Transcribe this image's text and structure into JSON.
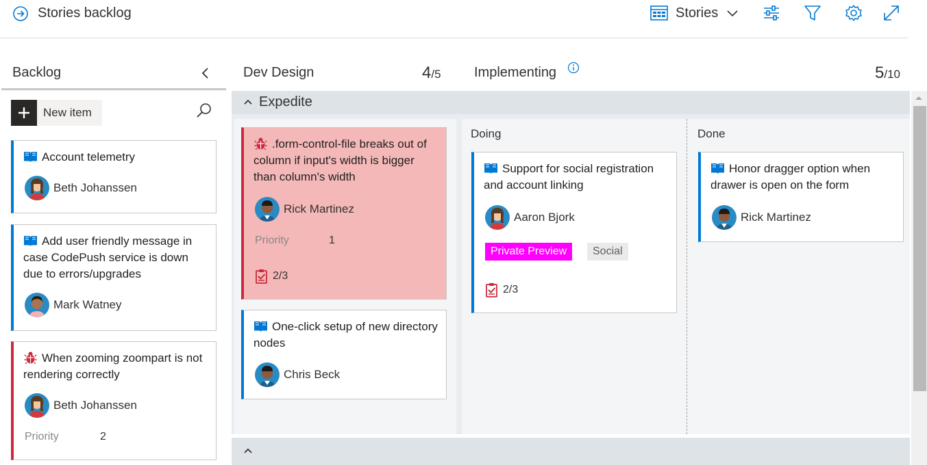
{
  "header": {
    "title": "Stories backlog",
    "board_selector": "Stories"
  },
  "backlog": {
    "title": "Backlog",
    "new_item_label": "New item"
  },
  "columns": {
    "dev_design": {
      "title": "Dev Design",
      "count": "4",
      "limit": "/5"
    },
    "implementing": {
      "title": "Implementing",
      "count": "5",
      "limit": "/10",
      "doing": "Doing",
      "done": "Done"
    }
  },
  "swimlane": {
    "title": "Expedite"
  },
  "labels": {
    "priority": "Priority"
  },
  "backlog_cards": [
    {
      "title": "Account telemetry",
      "assignee": "Beth Johanssen"
    },
    {
      "title": "Add user friendly message in case CodePush service is down due to errors/upgrades",
      "assignee": "Mark Watney"
    },
    {
      "title": "When zooming zoompart is not rendering correctly",
      "assignee": "Beth Johanssen",
      "priority": "2"
    }
  ],
  "dev_design_cards": [
    {
      "title": ".form-control-file breaks out of column if input's width is bigger than column's width",
      "assignee": "Rick Martinez",
      "priority": "1",
      "tasks": "2/3"
    },
    {
      "title": "One-click setup of new directory nodes",
      "assignee": "Chris Beck"
    }
  ],
  "doing_cards": [
    {
      "title": "Support for social registration and account linking",
      "assignee": "Aaron Bjork",
      "tags": [
        "Private Preview",
        "Social"
      ],
      "tasks": "2/3"
    }
  ],
  "done_cards": [
    {
      "title": "Honor dragger option when drawer is open on the form",
      "assignee": "Rick Martinez"
    }
  ],
  "colors": {
    "story_accent": "#0078d4",
    "bug_accent": "#cc293d",
    "expedite_card_bg": "#f4b8b8",
    "tag_private_preview_bg": "#ff00ff",
    "tag_default_bg": "#eaeaea"
  }
}
